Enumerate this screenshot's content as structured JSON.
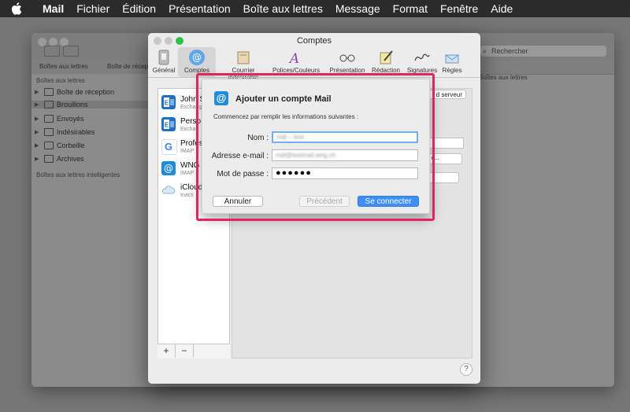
{
  "menubar": {
    "app": "Mail",
    "items": [
      "Fichier",
      "Édition",
      "Présentation",
      "Boîte aux lettres",
      "Message",
      "Format",
      "Fenêtre",
      "Aide"
    ]
  },
  "mail_window": {
    "toolbar_labels": [
      "Boîtes aux lettres",
      "Boîte de récep"
    ],
    "search_placeholder": "Rechercher",
    "sidebar_header": "Boîtes aux lettres",
    "mailboxes": [
      "Boîte de réception",
      "Brouillons",
      "Envoyés",
      "Indésirables",
      "Corbeille",
      "Archives"
    ],
    "smart_header": "Boîtes aux lettres intelligentes",
    "right_header": "Boîtes aux lettres"
  },
  "prefs": {
    "title": "Comptes",
    "tabs": [
      {
        "label": "Général",
        "icon": "general-icon"
      },
      {
        "label": "Comptes",
        "icon": "at-icon"
      },
      {
        "label": "Courrier indésirable",
        "icon": "junk-icon"
      },
      {
        "label": "Polices/Couleurs",
        "icon": "fonts-icon"
      },
      {
        "label": "Présentation",
        "icon": "glasses-icon"
      },
      {
        "label": "Rédaction",
        "icon": "compose-icon"
      },
      {
        "label": "Signatures",
        "icon": "signature-icon"
      },
      {
        "label": "Règles",
        "icon": "rules-icon"
      }
    ],
    "accounts": [
      {
        "name": "John S",
        "type": "Exchang",
        "icon": "exchange-icon",
        "color": "#1f6fc5"
      },
      {
        "name": "Perso",
        "type": "Exchan",
        "icon": "exchange-icon",
        "color": "#1f6fc5"
      },
      {
        "name": "Profes",
        "type": "IMAP",
        "icon": "google-icon",
        "color": "#ffffff"
      },
      {
        "name": "WNG",
        "type": "IMAP",
        "icon": "at-icon",
        "color": "#1e8cd9"
      },
      {
        "name": "iCloud",
        "type": "Inacti",
        "icon": "cloud-icon",
        "color": "#ffffff"
      }
    ],
    "add_label": "+",
    "remove_label": "−",
    "server_btn_label": "d serveur",
    "popup1_label": "up o...",
    "help_label": "?"
  },
  "sheet": {
    "title": "Ajouter un compte Mail",
    "info": "Commencez par remplir les informations suivantes :",
    "fields": {
      "name_label": "Nom :",
      "name_value": "mdl – test",
      "email_label": "Adresse e-mail :",
      "email_value": "mdl@testmail.wng.ch",
      "password_label": "Mot de passe :",
      "password_value": "●●●●●●"
    },
    "buttons": {
      "cancel": "Annuler",
      "previous": "Précédent",
      "connect": "Se connecter"
    }
  },
  "colors": {
    "highlight": "#e0245e",
    "primary_button": "#3e8ef7",
    "menubar": "#2b2b2b"
  }
}
